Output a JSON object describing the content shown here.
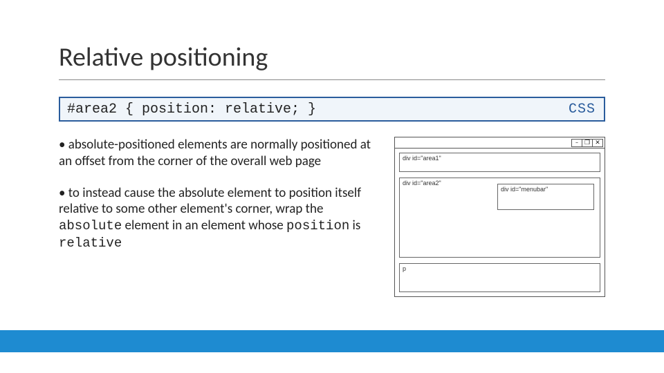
{
  "title": "Relative positioning",
  "codebox": {
    "code": "#area2 { position: relative; }",
    "lang": "CSS"
  },
  "bullets": {
    "b1_prefix": "•  absolute-positioned elements are normally positioned at an offset from the corner of the overall web page",
    "b2_a": "•  to instead cause the absolute element to position itself relative to some other element's corner, wrap the ",
    "b2_code1": "absolute",
    "b2_b": " element in an element whose ",
    "b2_code2": "position",
    "b2_c": " is ",
    "b2_code3": "relative"
  },
  "diagram": {
    "win_btn_min": "–",
    "win_btn_max": "❐",
    "win_btn_close": "✕",
    "area1": "div id=\"area1\"",
    "area2": "div id=\"area2\"",
    "menubar": "div id=\"menubar\"",
    "p": "p"
  }
}
